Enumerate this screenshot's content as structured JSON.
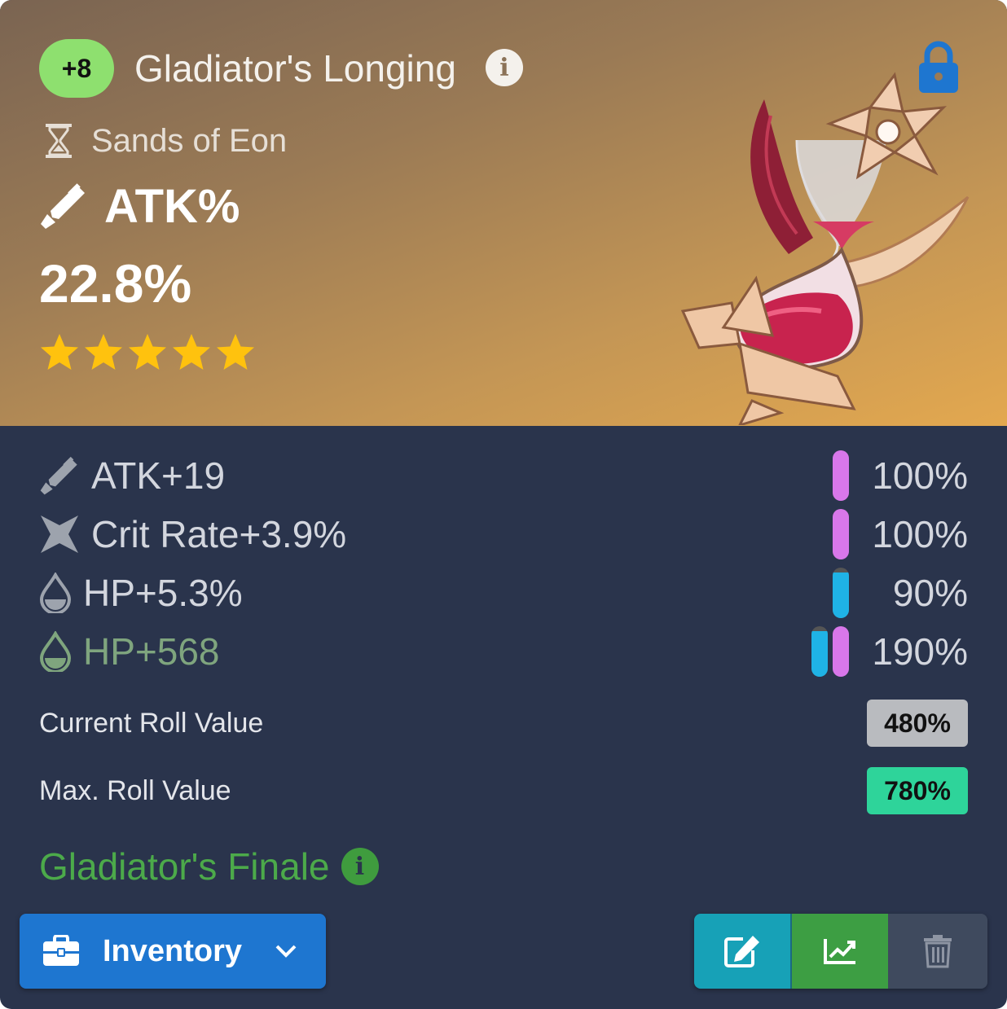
{
  "artifact": {
    "level": "+8",
    "name": "Gladiator's Longing",
    "slot": "Sands of Eon",
    "main_stat": "ATK%",
    "main_value": "22.8%",
    "rarity_stars": 5,
    "locked": true
  },
  "substats": [
    {
      "icon": "sword-icon",
      "label": "ATK+19",
      "percent": "100%",
      "rolls": [
        {
          "color": "#d877ea",
          "level": 1.0
        }
      ],
      "highlight": false
    },
    {
      "icon": "crit-star-icon",
      "label": "Crit Rate+3.9%",
      "percent": "100%",
      "rolls": [
        {
          "color": "#d877ea",
          "level": 1.0
        }
      ],
      "highlight": false
    },
    {
      "icon": "hp-drop-icon",
      "label": "HP+5.3%",
      "percent": "90%",
      "rolls": [
        {
          "color": "#1fb3e6",
          "level": 0.9
        }
      ],
      "highlight": false
    },
    {
      "icon": "hp-drop-icon",
      "label": "HP+568",
      "percent": "190%",
      "rolls": [
        {
          "color": "#1fb3e6",
          "level": 0.9
        },
        {
          "color": "#d877ea",
          "level": 1.0
        }
      ],
      "highlight": true
    }
  ],
  "roll_value": {
    "current_label": "Current Roll Value",
    "current_value": "480%",
    "current_color": "#b9bbbf",
    "max_label": "Max. Roll Value",
    "max_value": "780%",
    "max_color": "#2ed49a"
  },
  "set": {
    "name": "Gladiator's Finale",
    "color": "#4caa4a"
  },
  "actions": {
    "inventory_label": "Inventory",
    "edit_icon": "edit-icon",
    "chart_icon": "chart-line-icon",
    "delete_icon": "trash-icon"
  },
  "colors": {
    "lock": "#1e76d0",
    "star": "#ffc20e",
    "level_badge": "#8ee06f"
  }
}
